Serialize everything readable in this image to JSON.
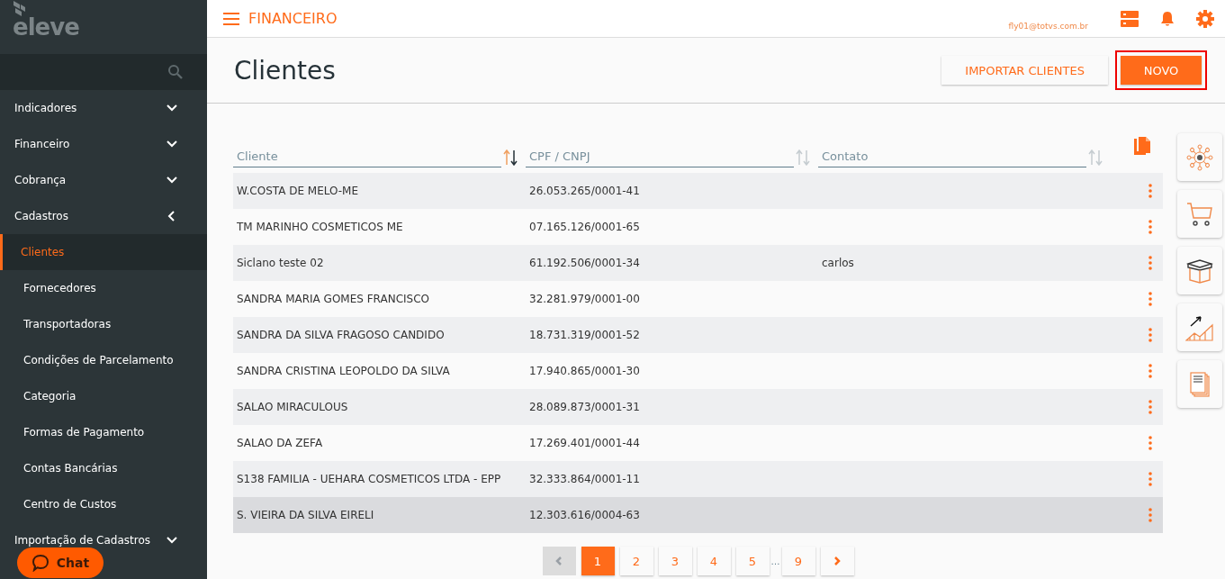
{
  "sidebar": {
    "logo": "eleve",
    "items": [
      {
        "label": "Indicadores",
        "expanded": false
      },
      {
        "label": "Financeiro",
        "expanded": false
      },
      {
        "label": "Cobrança",
        "expanded": false
      },
      {
        "label": "Cadastros",
        "expanded": true,
        "children": [
          {
            "label": "Clientes",
            "selected": true
          },
          {
            "label": "Fornecedores",
            "selected": false
          },
          {
            "label": "Transportadoras",
            "selected": false
          },
          {
            "label": "Condições de Parcelamento",
            "selected": false
          },
          {
            "label": "Categoria",
            "selected": false
          },
          {
            "label": "Formas de Pagamento",
            "selected": false
          },
          {
            "label": "Contas Bancárias",
            "selected": false
          },
          {
            "label": "Centro de Custos",
            "selected": false
          }
        ]
      },
      {
        "label": "Importação de Cadastros",
        "expanded": false
      }
    ]
  },
  "chat_button": {
    "label": "Chat"
  },
  "top_bar": {
    "module": "FINANCEIRO",
    "user": "fly01@totvs.com.br"
  },
  "page": {
    "title": "Clientes",
    "buttons": [
      {
        "label": "IMPORTAR CLIENTES",
        "kind": "flat"
      },
      {
        "label": "NOVO",
        "kind": "primary"
      }
    ]
  },
  "table": {
    "columns": [
      {
        "label": "Cliente",
        "sorted": true
      },
      {
        "label": "CPF / CNPJ",
        "sorted": false
      },
      {
        "label": "Contato",
        "sorted": false
      }
    ],
    "rows": [
      {
        "cliente": "W.COSTA DE MELO-ME",
        "cpf_cnpj": "26.053.265/0001-41",
        "contato": "",
        "hovered": false
      },
      {
        "cliente": "TM MARINHO COSMETICOS ME",
        "cpf_cnpj": "07.165.126/0001-65",
        "contato": "",
        "hovered": false
      },
      {
        "cliente": "Siclano teste 02",
        "cpf_cnpj": "61.192.506/0001-34",
        "contato": "carlos",
        "hovered": false
      },
      {
        "cliente": "SANDRA MARIA GOMES FRANCISCO",
        "cpf_cnpj": "32.281.979/0001-00",
        "contato": "",
        "hovered": false
      },
      {
        "cliente": "SANDRA DA SILVA FRAGOSO CANDIDO",
        "cpf_cnpj": "18.731.319/0001-52",
        "contato": "",
        "hovered": false
      },
      {
        "cliente": "SANDRA CRISTINA LEOPOLDO DA SILVA",
        "cpf_cnpj": "17.940.865/0001-30",
        "contato": "",
        "hovered": false
      },
      {
        "cliente": "SALAO MIRACULOUS",
        "cpf_cnpj": "28.089.873/0001-31",
        "contato": "",
        "hovered": false
      },
      {
        "cliente": "SALAO DA ZEFA",
        "cpf_cnpj": "17.269.401/0001-44",
        "contato": "",
        "hovered": false
      },
      {
        "cliente": "S138 FAMILIA - UEHARA COSMETICOS LTDA - EPP",
        "cpf_cnpj": "32.333.864/0001-11",
        "contato": "",
        "hovered": false
      },
      {
        "cliente": "S. VIEIRA DA SILVA EIRELI",
        "cpf_cnpj": "12.303.616/0004-63",
        "contato": "",
        "hovered": true
      }
    ]
  },
  "pagination": {
    "pages_before": [
      {
        "label": "1",
        "selected": true
      },
      {
        "label": "2",
        "selected": false
      },
      {
        "label": "3",
        "selected": false
      },
      {
        "label": "4",
        "selected": false
      },
      {
        "label": "5",
        "selected": false
      }
    ],
    "ellipsis": "…",
    "pages_after": [
      {
        "label": "9",
        "selected": false
      }
    ],
    "prev_disabled": true,
    "next_disabled": false
  },
  "side_shortcuts": [
    {
      "kind": "network"
    },
    {
      "kind": "cart"
    },
    {
      "kind": "box"
    },
    {
      "kind": "chart"
    },
    {
      "kind": "docs"
    }
  ]
}
